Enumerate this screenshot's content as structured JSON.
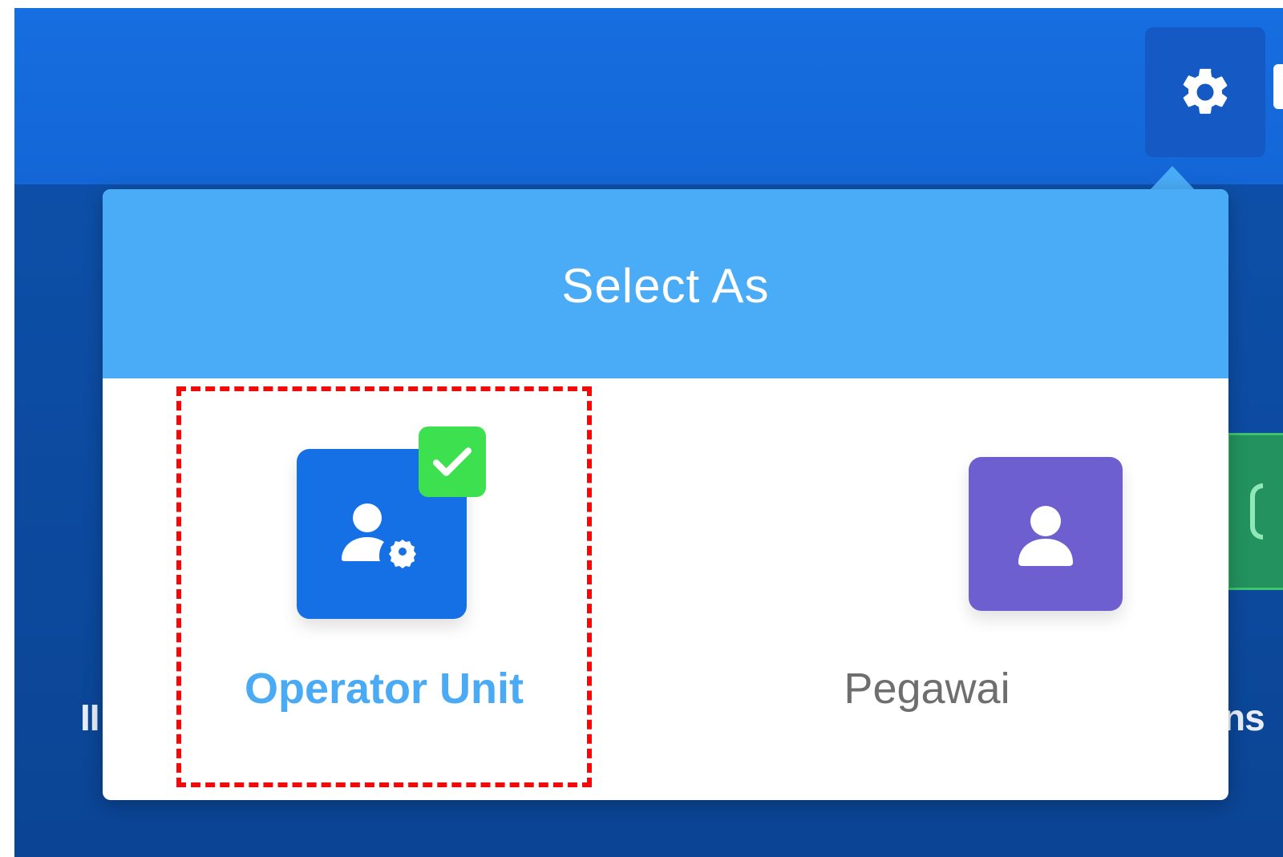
{
  "header": {
    "settings_icon": "gear-icon"
  },
  "background": {
    "left_label_fragment": "II",
    "right_label_fragment": "ns"
  },
  "popup": {
    "title": "Select As",
    "options": [
      {
        "label": "Operator Unit",
        "icon": "user-gear-icon",
        "selected": true,
        "color": "#1570e6"
      },
      {
        "label": "Pegawai",
        "icon": "user-icon",
        "selected": false,
        "color": "#6d5fcf"
      }
    ],
    "selected_badge_icon": "check-icon"
  },
  "colors": {
    "header_blue": "#166ee0",
    "popup_header": "#4aabf6",
    "selected_label": "#4aaaf4",
    "check_green": "#3de04f",
    "highlight_red": "#f00a0a"
  }
}
